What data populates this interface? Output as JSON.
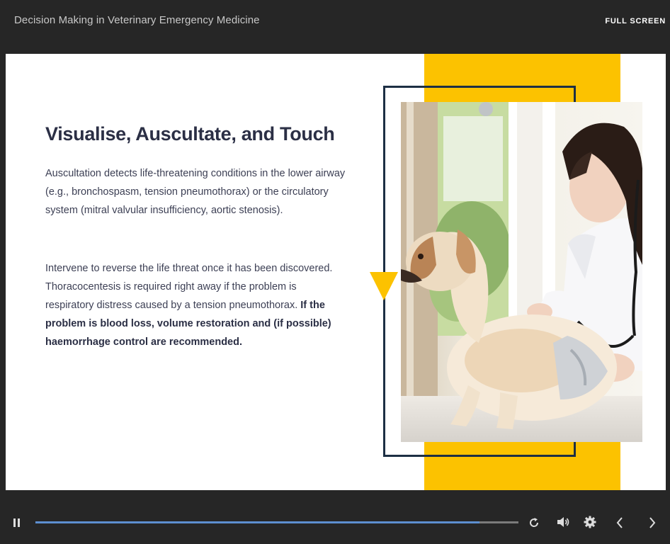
{
  "header": {
    "course_title": "Decision Making in Veterinary Emergency Medicine",
    "fullscreen_label": "FULL SCREEN"
  },
  "slide": {
    "heading": "Visualise, Auscultate, and Touch",
    "paragraph1": "Auscultation detects life-threatening conditions in the lower airway (e.g., bronchospasm, tension pneumothorax) or the circulatory system (mitral valvular insufficiency, aortic stenosis).",
    "paragraph2_regular": "Intervene to reverse the life threat once it has been discovered. Thoracocentesis is required right away if the problem is respiratory distress caused by a tension pneumothorax. ",
    "paragraph2_bold": "If the problem is blood loss, volume restoration and (if possible) haemorrhage control are recommended."
  },
  "player": {
    "progress": 0.92,
    "icons": {
      "pause": "pause-icon",
      "replay": "replay-icon",
      "volume": "volume-icon",
      "settings": "gear-icon",
      "previous": "chevron-left-icon",
      "next": "chevron-right-icon"
    }
  },
  "colors": {
    "accent_yellow": "#fcc200",
    "frame_navy": "#1d2f44",
    "progress_blue": "#5d8fd0",
    "player_background": "#262626"
  }
}
